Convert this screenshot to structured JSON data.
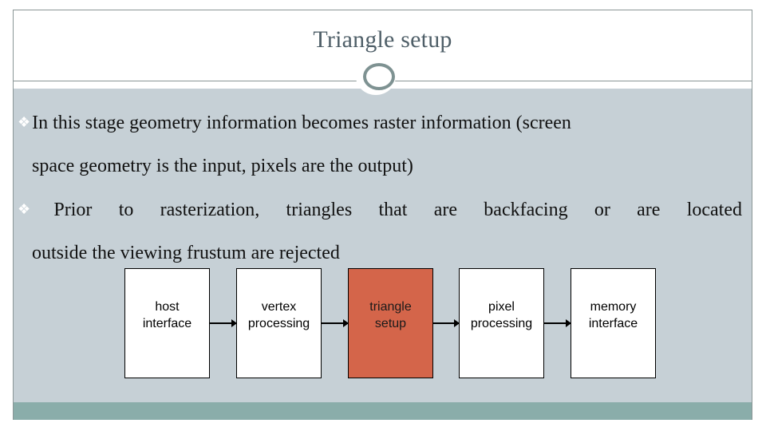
{
  "slide": {
    "title": "Triangle setup",
    "bullet_icon": "diamond-cluster-icon",
    "bullets": [
      {
        "line1": "In this stage geometry information becomes raster information (screen",
        "line2": "space geometry is the input, pixels are the output)"
      },
      {
        "line1": "Prior to rasterization, triangles that are backfacing or are located",
        "line2": "outside the viewing frustum are rejected"
      }
    ]
  },
  "chart_data": {
    "type": "diagram",
    "title": "",
    "nodes": [
      {
        "id": "host",
        "line1": "host",
        "line2": "interface",
        "highlighted": false
      },
      {
        "id": "vertex",
        "line1": "vertex",
        "line2": "processing",
        "highlighted": false
      },
      {
        "id": "triangle",
        "line1": "triangle",
        "line2": "setup",
        "highlighted": true
      },
      {
        "id": "pixel",
        "line1": "pixel",
        "line2": "processing",
        "highlighted": false
      },
      {
        "id": "memory",
        "line1": "memory",
        "line2": "interface",
        "highlighted": false
      }
    ],
    "edges": [
      {
        "from": "host",
        "to": "vertex"
      },
      {
        "from": "vertex",
        "to": "triangle"
      },
      {
        "from": "triangle",
        "to": "pixel"
      },
      {
        "from": "pixel",
        "to": "memory"
      }
    ],
    "highlight_color": "#d4654a"
  }
}
